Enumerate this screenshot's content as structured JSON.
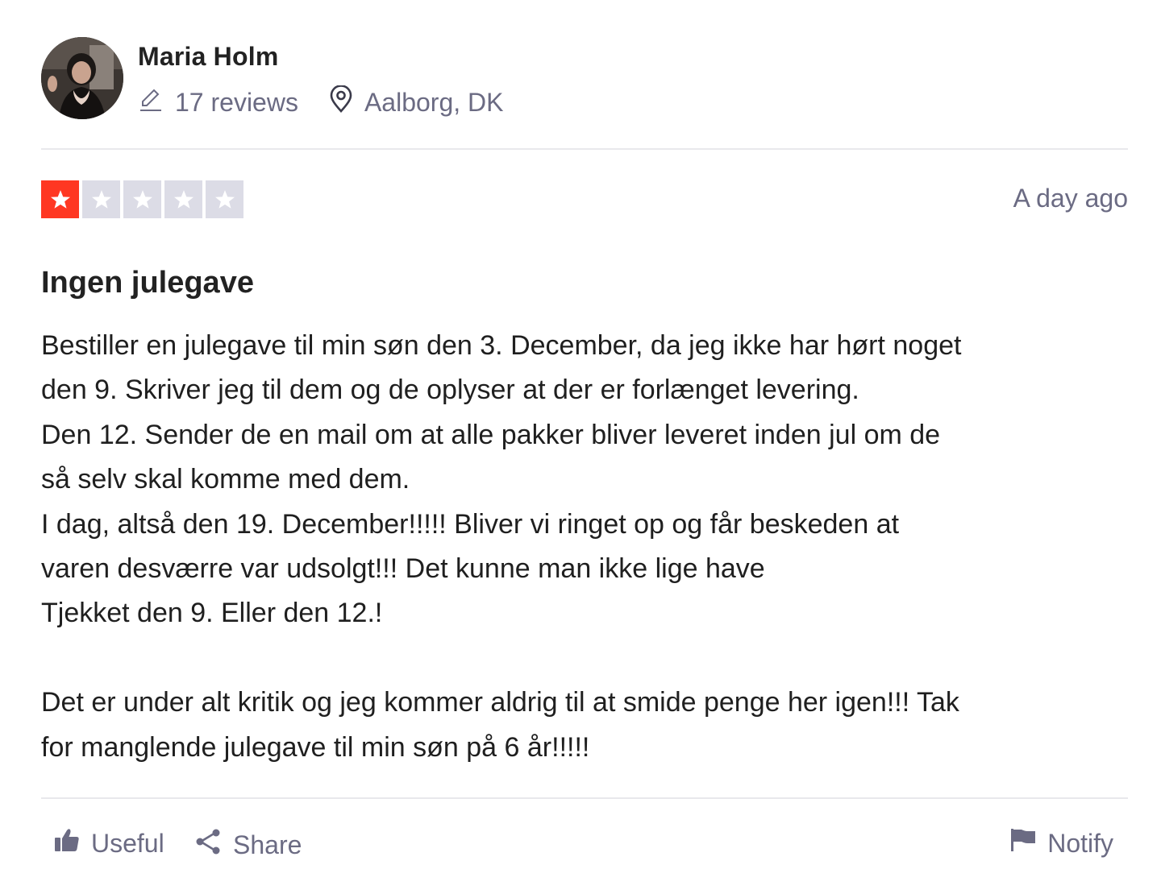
{
  "reviewer": {
    "name": "Maria Holm",
    "reviews_count": "17 reviews",
    "location": "Aalborg, DK"
  },
  "review": {
    "rating": 1,
    "rating_max": 5,
    "date": "A day ago",
    "title": "Ingen julegave",
    "body": "Bestiller en julegave til min søn den 3. December, da jeg ikke har hørt noget\nden 9. Skriver jeg til dem og de oplyser at der er forlænget levering.\nDen 12. Sender de en mail om at alle pakker bliver leveret inden jul om de\nså selv skal komme med dem.\nI dag, altså den 19. December!!!!! Bliver vi ringet op og får beskeden at\nvaren desværre var udsolgt!!! Det kunne man ikke lige have\nTjekket den 9. Eller den 12.!\n\nDet er under alt kritik og jeg kommer aldrig til at smide penge her igen!!! Tak\nfor manglende julegave til min søn på 6 år!!!!!"
  },
  "actions": {
    "useful_label": "Useful",
    "share_label": "Share",
    "notify_label": "Notify"
  },
  "colors": {
    "star_filled": "#ff3722",
    "star_empty": "#dcdce6",
    "muted_text": "#6b6b83"
  },
  "icons": {
    "reviews": "pencil-icon",
    "location": "location-pin-icon",
    "useful": "thumbs-up-icon",
    "share": "share-icon",
    "notify": "flag-icon"
  }
}
